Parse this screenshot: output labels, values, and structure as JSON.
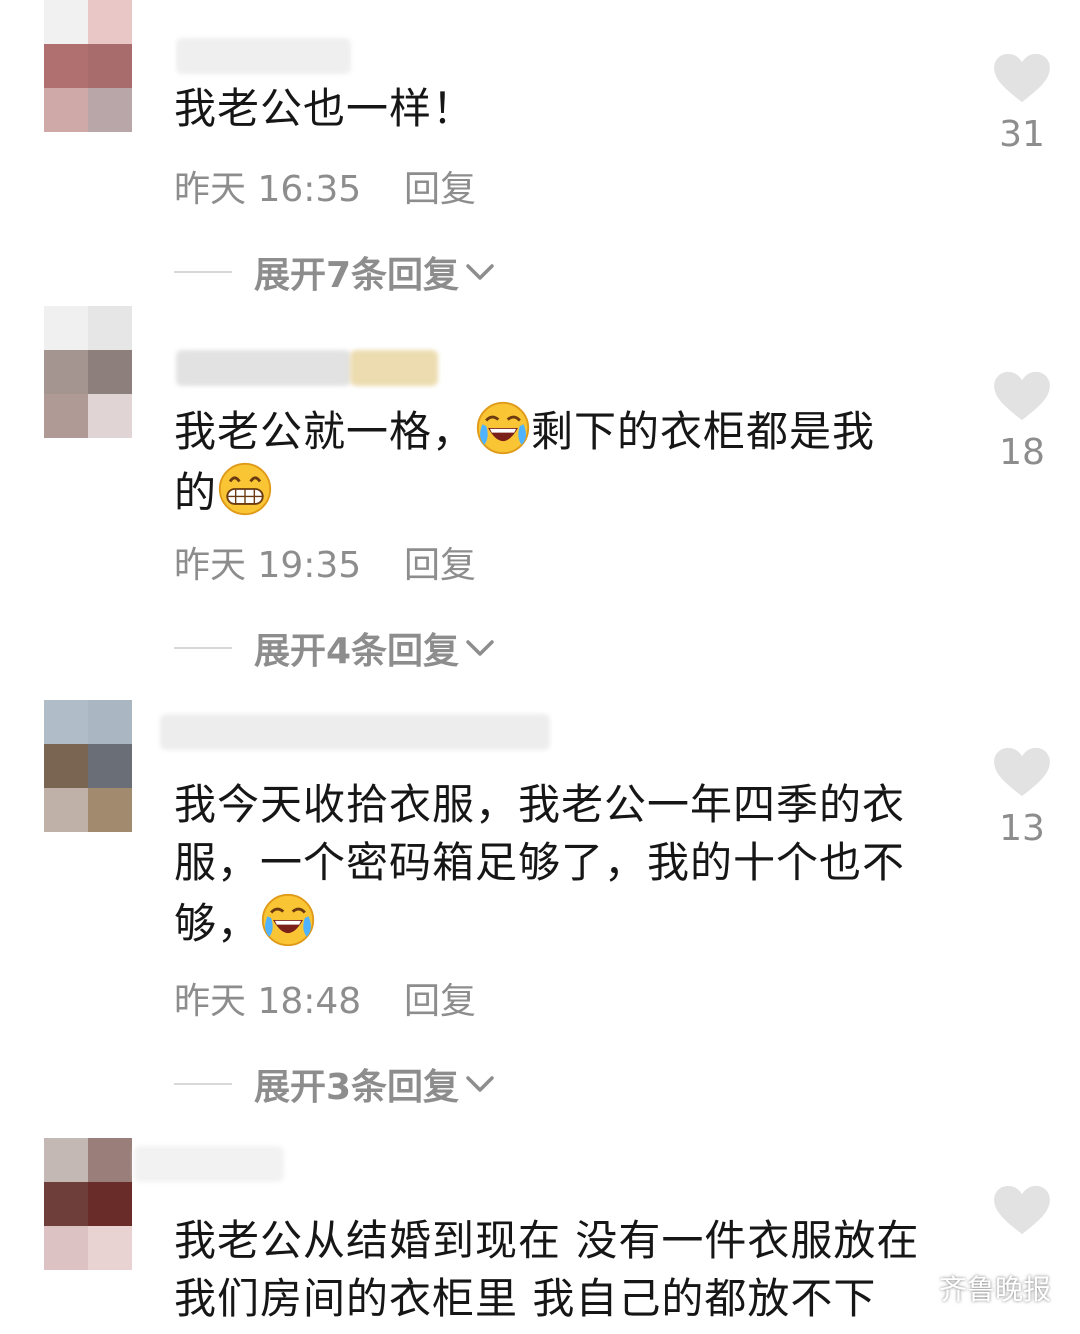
{
  "comments": [
    {
      "text_segments": [
        "我老公也一样！"
      ],
      "time": "昨天 16:35",
      "reply_label": "回复",
      "expand_label": "展开7条回复",
      "likes": "31"
    },
    {
      "text_segments": [
        "我老公就一格，",
        "剩下的衣柜都是我",
        "的"
      ],
      "time": "昨天 19:35",
      "reply_label": "回复",
      "expand_label": "展开4条回复",
      "likes": "18"
    },
    {
      "text_segments": [
        "我今天收拾衣服，我老公一年四季的衣",
        "服，一个密码箱足够了，我的十个也不",
        "够，"
      ],
      "time": "昨天 18:48",
      "reply_label": "回复",
      "expand_label": "展开3条回复",
      "likes": "13"
    },
    {
      "text_segments": [
        "我老公从结婚到现在 没有一件衣服放在",
        "我们房间的衣柜里 我自己的都放不下"
      ]
    }
  ],
  "watermark": {
    "text": "齐鲁晚报",
    "icon": "wechat-icon"
  },
  "icons": {
    "like": "heart-icon",
    "expand": "chevron-down-icon",
    "emoji_laugh_cry": "rolling-laugh-emoji",
    "emoji_grin": "grin-emoji"
  },
  "colors": {
    "text": "#161616",
    "meta": "#8d8d8d",
    "heart": "#e2e2e2"
  }
}
